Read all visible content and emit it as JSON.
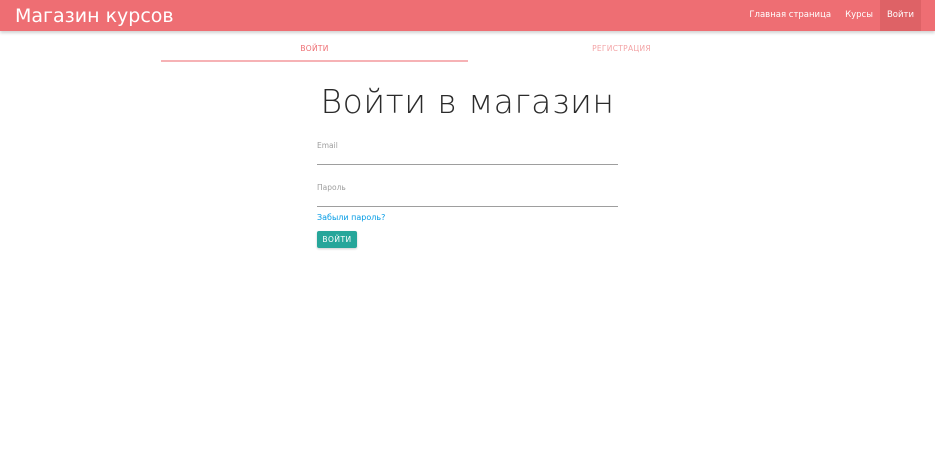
{
  "navbar": {
    "brand": "Магазин курсов",
    "links": [
      {
        "label": "Главная страница"
      },
      {
        "label": "Курсы"
      },
      {
        "label": "Войти"
      }
    ],
    "color": "#ee6e73"
  },
  "tabs": [
    {
      "label": "ВОЙТИ",
      "active": true
    },
    {
      "label": "РЕГИСТРАЦИЯ",
      "active": false
    }
  ],
  "form": {
    "title": "Войти в магазин",
    "email_label": "Email",
    "email_value": "",
    "password_label": "Пароль",
    "password_value": "",
    "forgot_link": "Забыли пароль?",
    "submit_label": "ВОЙТИ",
    "submit_color": "#26a69a"
  }
}
